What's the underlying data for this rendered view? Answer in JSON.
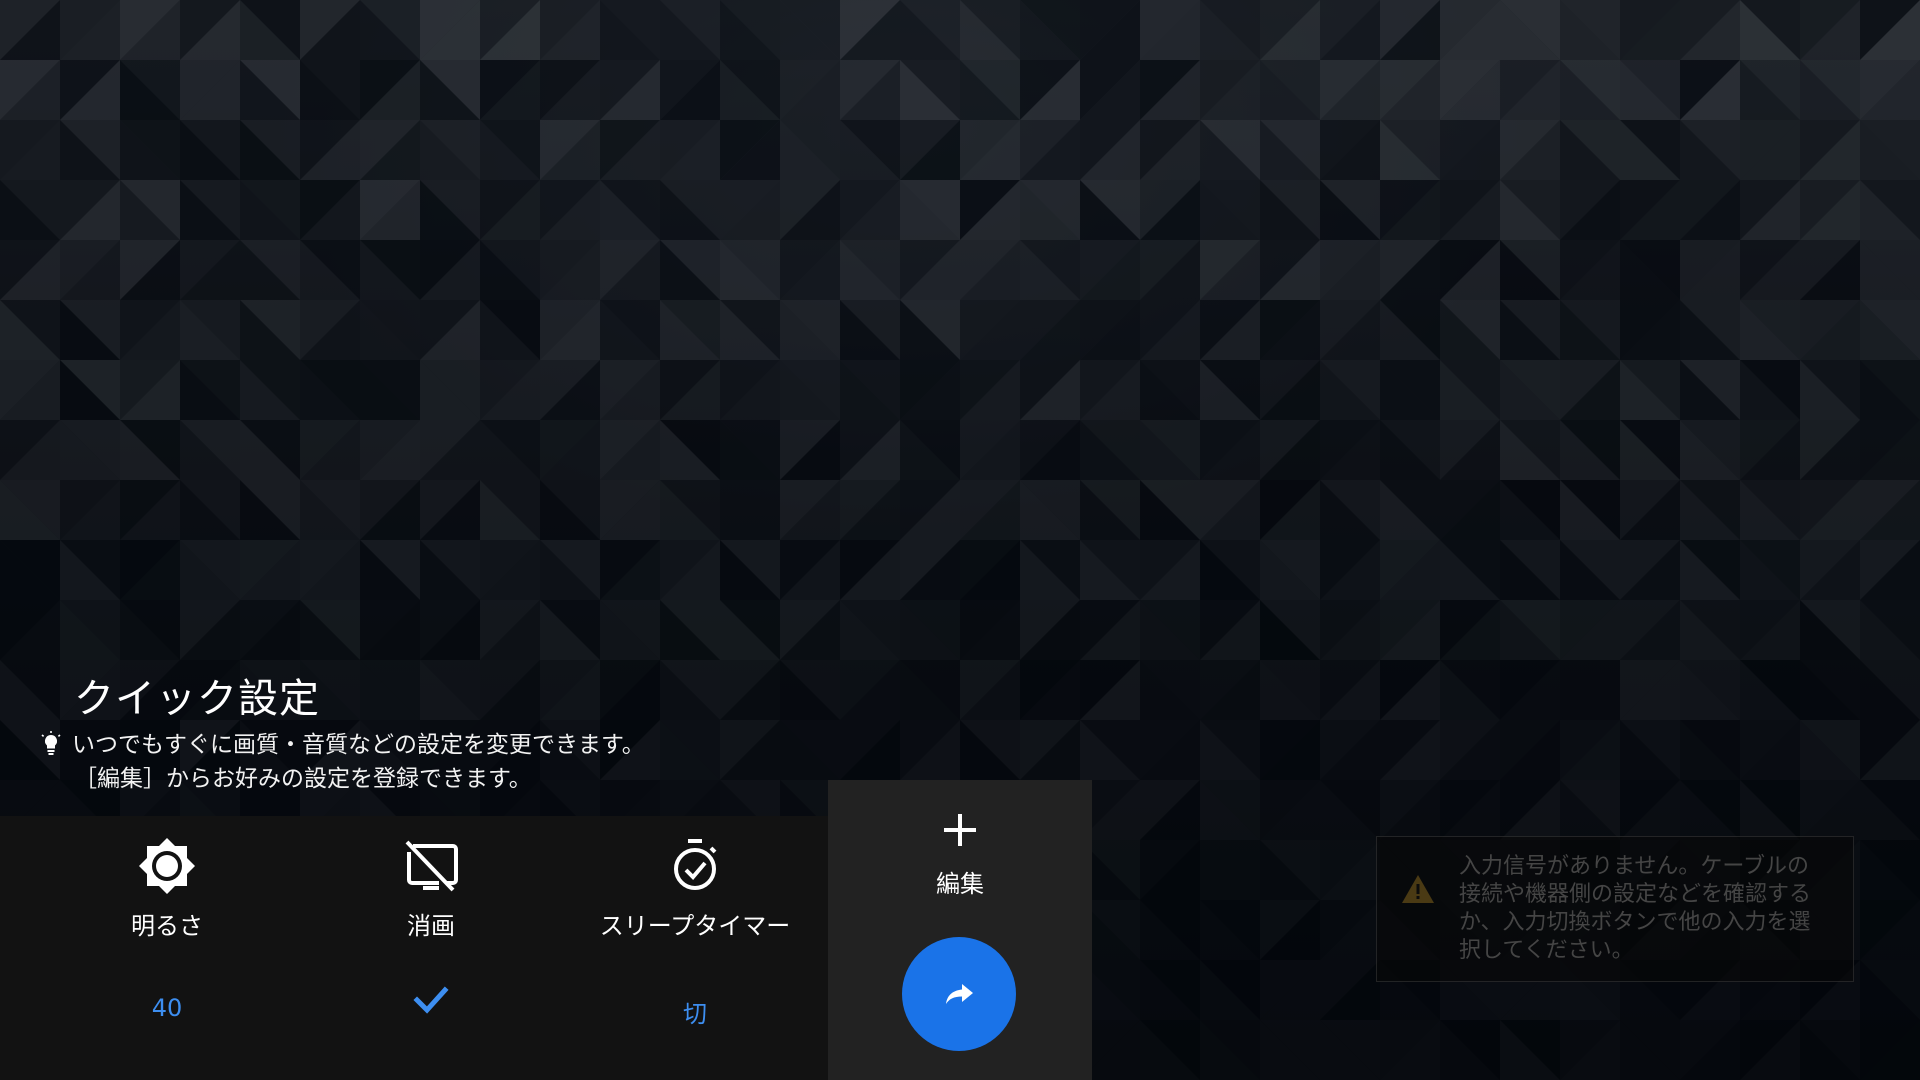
{
  "quick_settings": {
    "title": "クイック設定",
    "hint_line1": "いつでもすぐに画質・音質などの設定を変更できます。",
    "hint_line2": "［編集］からお好みの設定を登録できます。",
    "tiles": [
      {
        "label": "明るさ",
        "value": "40",
        "icon": "brightness-icon"
      },
      {
        "label": "消画",
        "state": "checked",
        "icon": "picture-off-icon"
      },
      {
        "label": "スリープタイマー",
        "value": "切",
        "icon": "sleep-timer-icon"
      }
    ],
    "edit": {
      "label": "編集",
      "icon": "plus-icon",
      "fab_icon": "share-arrow-icon"
    }
  },
  "notice": {
    "icon": "warning-icon",
    "message": "入力信号がありません。ケーブルの接続や機器側の設定などを確認するか、入力切換ボタンで他の入力を選択してください。"
  },
  "colors": {
    "accent": "#1a73e8",
    "value_text": "#3d8ef0",
    "panel": "#121212",
    "edit_panel": "#222222"
  }
}
